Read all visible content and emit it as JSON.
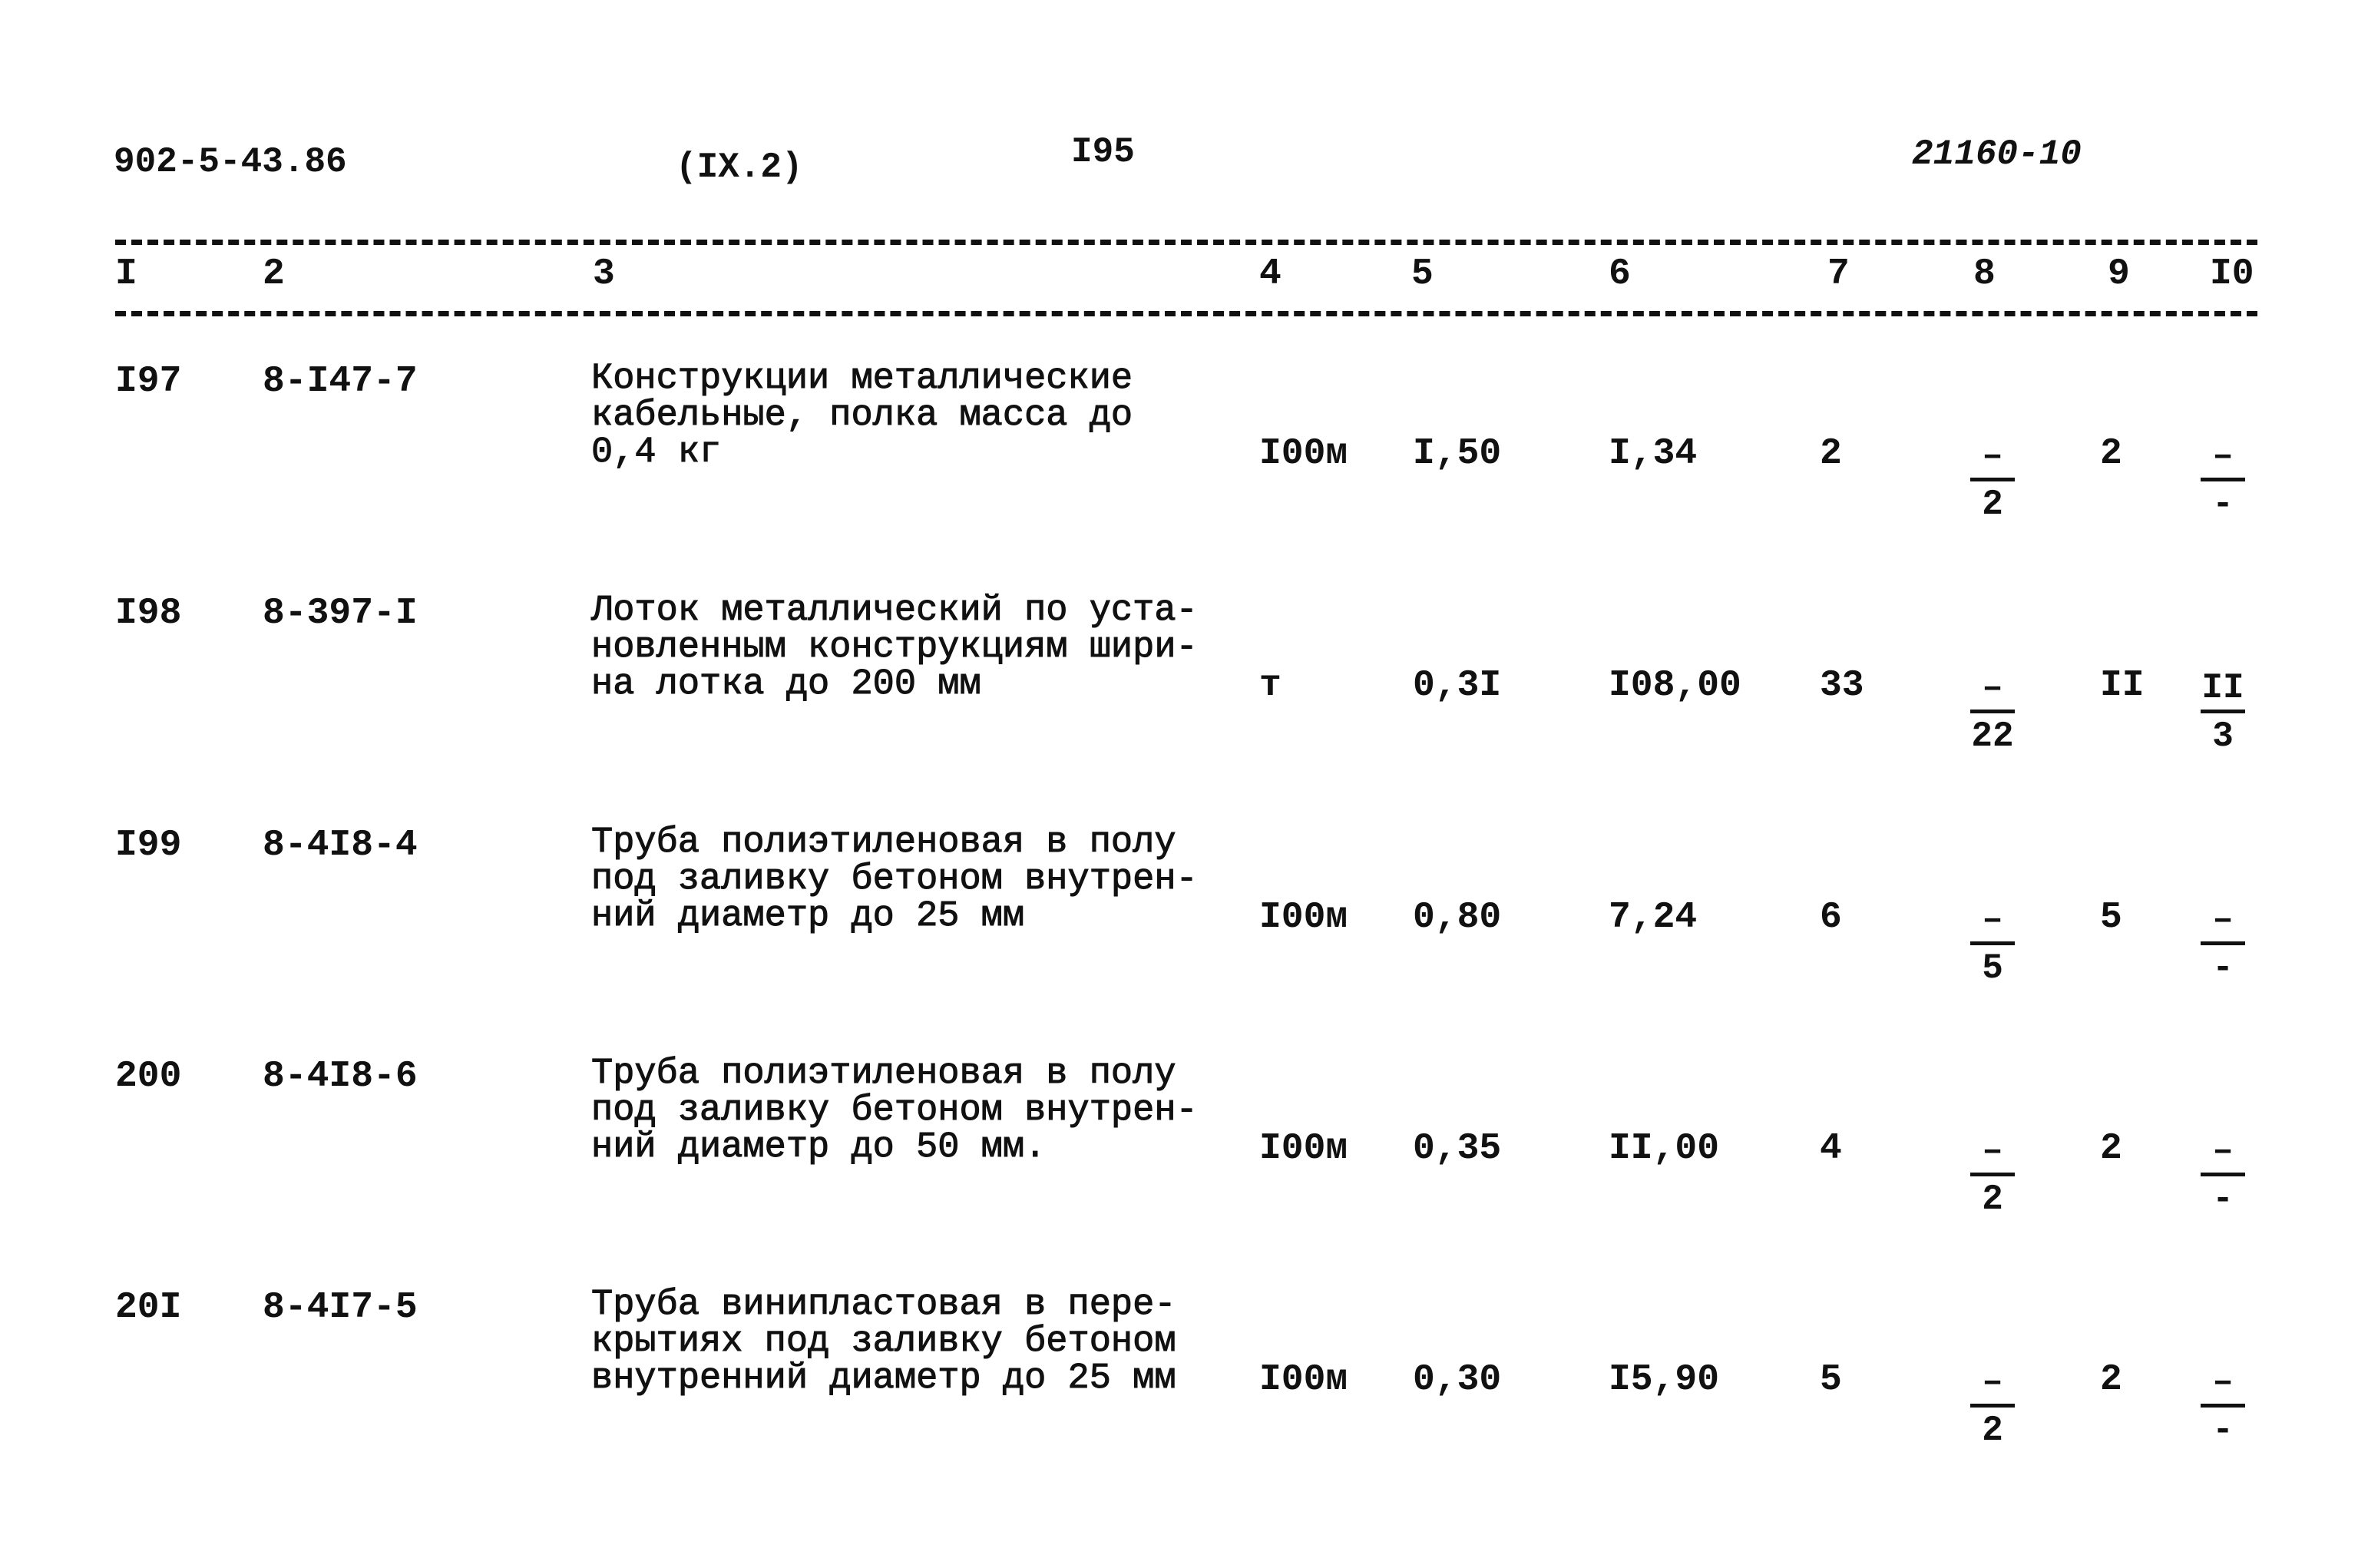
{
  "header": {
    "doc_code": "902-5-43.86",
    "section": "(IX.2)",
    "page": "I95",
    "stamp": "21160-10"
  },
  "columns": [
    "I",
    "2",
    "3",
    "4",
    "5",
    "6",
    "7",
    "8",
    "9",
    "I0"
  ],
  "rows": [
    {
      "n": "I97",
      "code": "8-I47-7",
      "desc": "Конструкции металлические\nкабельные, полка масса до\n0,4 кг",
      "unit": "I00м",
      "c5": "I,50",
      "c6": "I,34",
      "c7": "2",
      "c8_num": "–",
      "c8_den": "2",
      "c9": "2",
      "c10_num": "–",
      "c10_den": "-"
    },
    {
      "n": "I98",
      "code": "8-397-I",
      "desc": "Лоток металлический по уста-\nновленным конструкциям шири-\nна лотка до 200 мм",
      "unit": "т",
      "c5": "0,3I",
      "c6": "I08,00",
      "c7": "33",
      "c8_num": "–",
      "c8_den": "22",
      "c9": "II",
      "c10_num": "II",
      "c10_den": "3"
    },
    {
      "n": "I99",
      "code": "8-4I8-4",
      "desc": "Труба полиэтиленовая в полу\nпод заливку бетоном внутрен-\nний диаметр до 25 мм",
      "unit": "I00м",
      "c5": "0,80",
      "c6": "7,24",
      "c7": "6",
      "c8_num": "–",
      "c8_den": "5",
      "c9": "5",
      "c10_num": "–",
      "c10_den": "-"
    },
    {
      "n": "200",
      "code": "8-4I8-6",
      "desc": "Труба полиэтиленовая в полу\nпод заливку бетоном внутрен-\nний диаметр до 50 мм.",
      "unit": "I00м",
      "c5": "0,35",
      "c6": "II,00",
      "c7": "4",
      "c8_num": "–",
      "c8_den": "2",
      "c9": "2",
      "c10_num": "–",
      "c10_den": "-"
    },
    {
      "n": "20I",
      "code": "8-4I7-5",
      "desc": "Труба винипластовая в пере-\nкрытиях под заливку бетоном\nвнутренний диаметр до 25 мм",
      "unit": "I00м",
      "c5": "0,30",
      "c6": "I5,90",
      "c7": "5",
      "c8_num": "–",
      "c8_den": "2",
      "c9": "2",
      "c10_num": "–",
      "c10_den": "-"
    }
  ]
}
